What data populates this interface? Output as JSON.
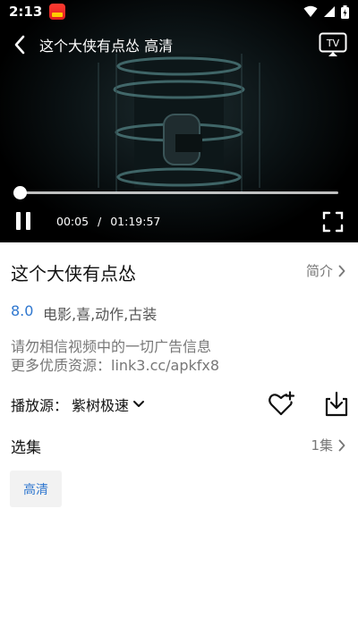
{
  "status_bar": {
    "time": "2:13"
  },
  "player": {
    "title": "这个大侠有点怂 高清",
    "current_time": "00:05",
    "separator": "/",
    "duration": "01:19:57",
    "progress_fraction": 0.001,
    "tv_label": "TV"
  },
  "info": {
    "title": "这个大侠有点怂",
    "intro_label": "简介",
    "rating": "8.0",
    "genres": "电影,喜,动作,古装",
    "notice_line1": "请勿相信视频中的一切广告信息",
    "notice_line2": "更多优质资源：link3.cc/apkfx8",
    "source_label": "播放源：",
    "source_value": "紫树极速"
  },
  "episodes": {
    "title": "选集",
    "count": "1集",
    "items": [
      {
        "label": "高清"
      }
    ]
  },
  "colors": {
    "accent": "#2f77cf",
    "player_bg": "#000000"
  }
}
